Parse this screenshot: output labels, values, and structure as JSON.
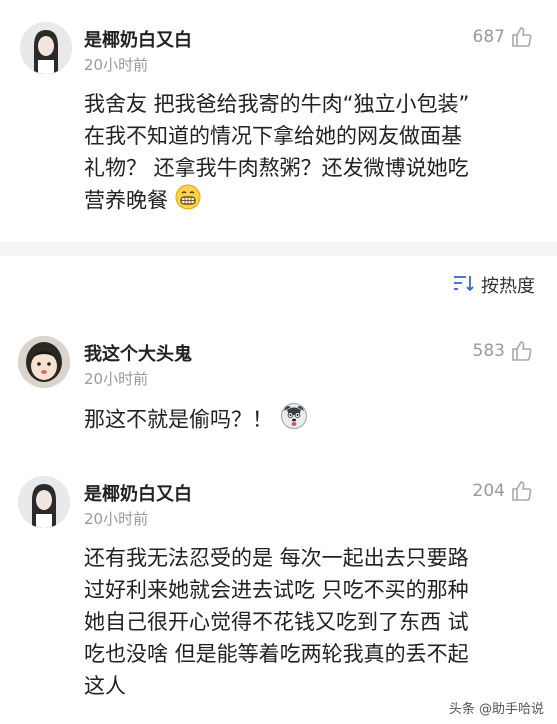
{
  "comments": [
    {
      "username": "是椰奶白又白",
      "time": "20小时前",
      "likes": "687",
      "lines": [
        "我舍友 把我爸给我寄的牛肉“独立小包装”",
        "在我不知道的情况下拿给她的网友做面基",
        "礼物？ 还拿我牛肉熬粥？还发微博说她吃",
        "营养晚餐"
      ]
    },
    {
      "username": "我这个大头鬼",
      "time": "20小时前",
      "likes": "583",
      "lines": [
        "那这不就是偷吗？！"
      ]
    },
    {
      "username": "是椰奶白又白",
      "time": "20小时前",
      "likes": "204",
      "lines": [
        "还有我无法忍受的是 每次一起出去只要路",
        "过好利来她就会进去试吃 只吃不买的那种",
        "她自己很开心觉得不花钱又吃到了东西 试",
        "吃也没啥 但是能等着吃两轮我真的丢不起",
        "这人"
      ]
    }
  ],
  "sort": {
    "label": "按热度",
    "icon": "sort-icon"
  },
  "watermark": "头条 @助手哈说"
}
